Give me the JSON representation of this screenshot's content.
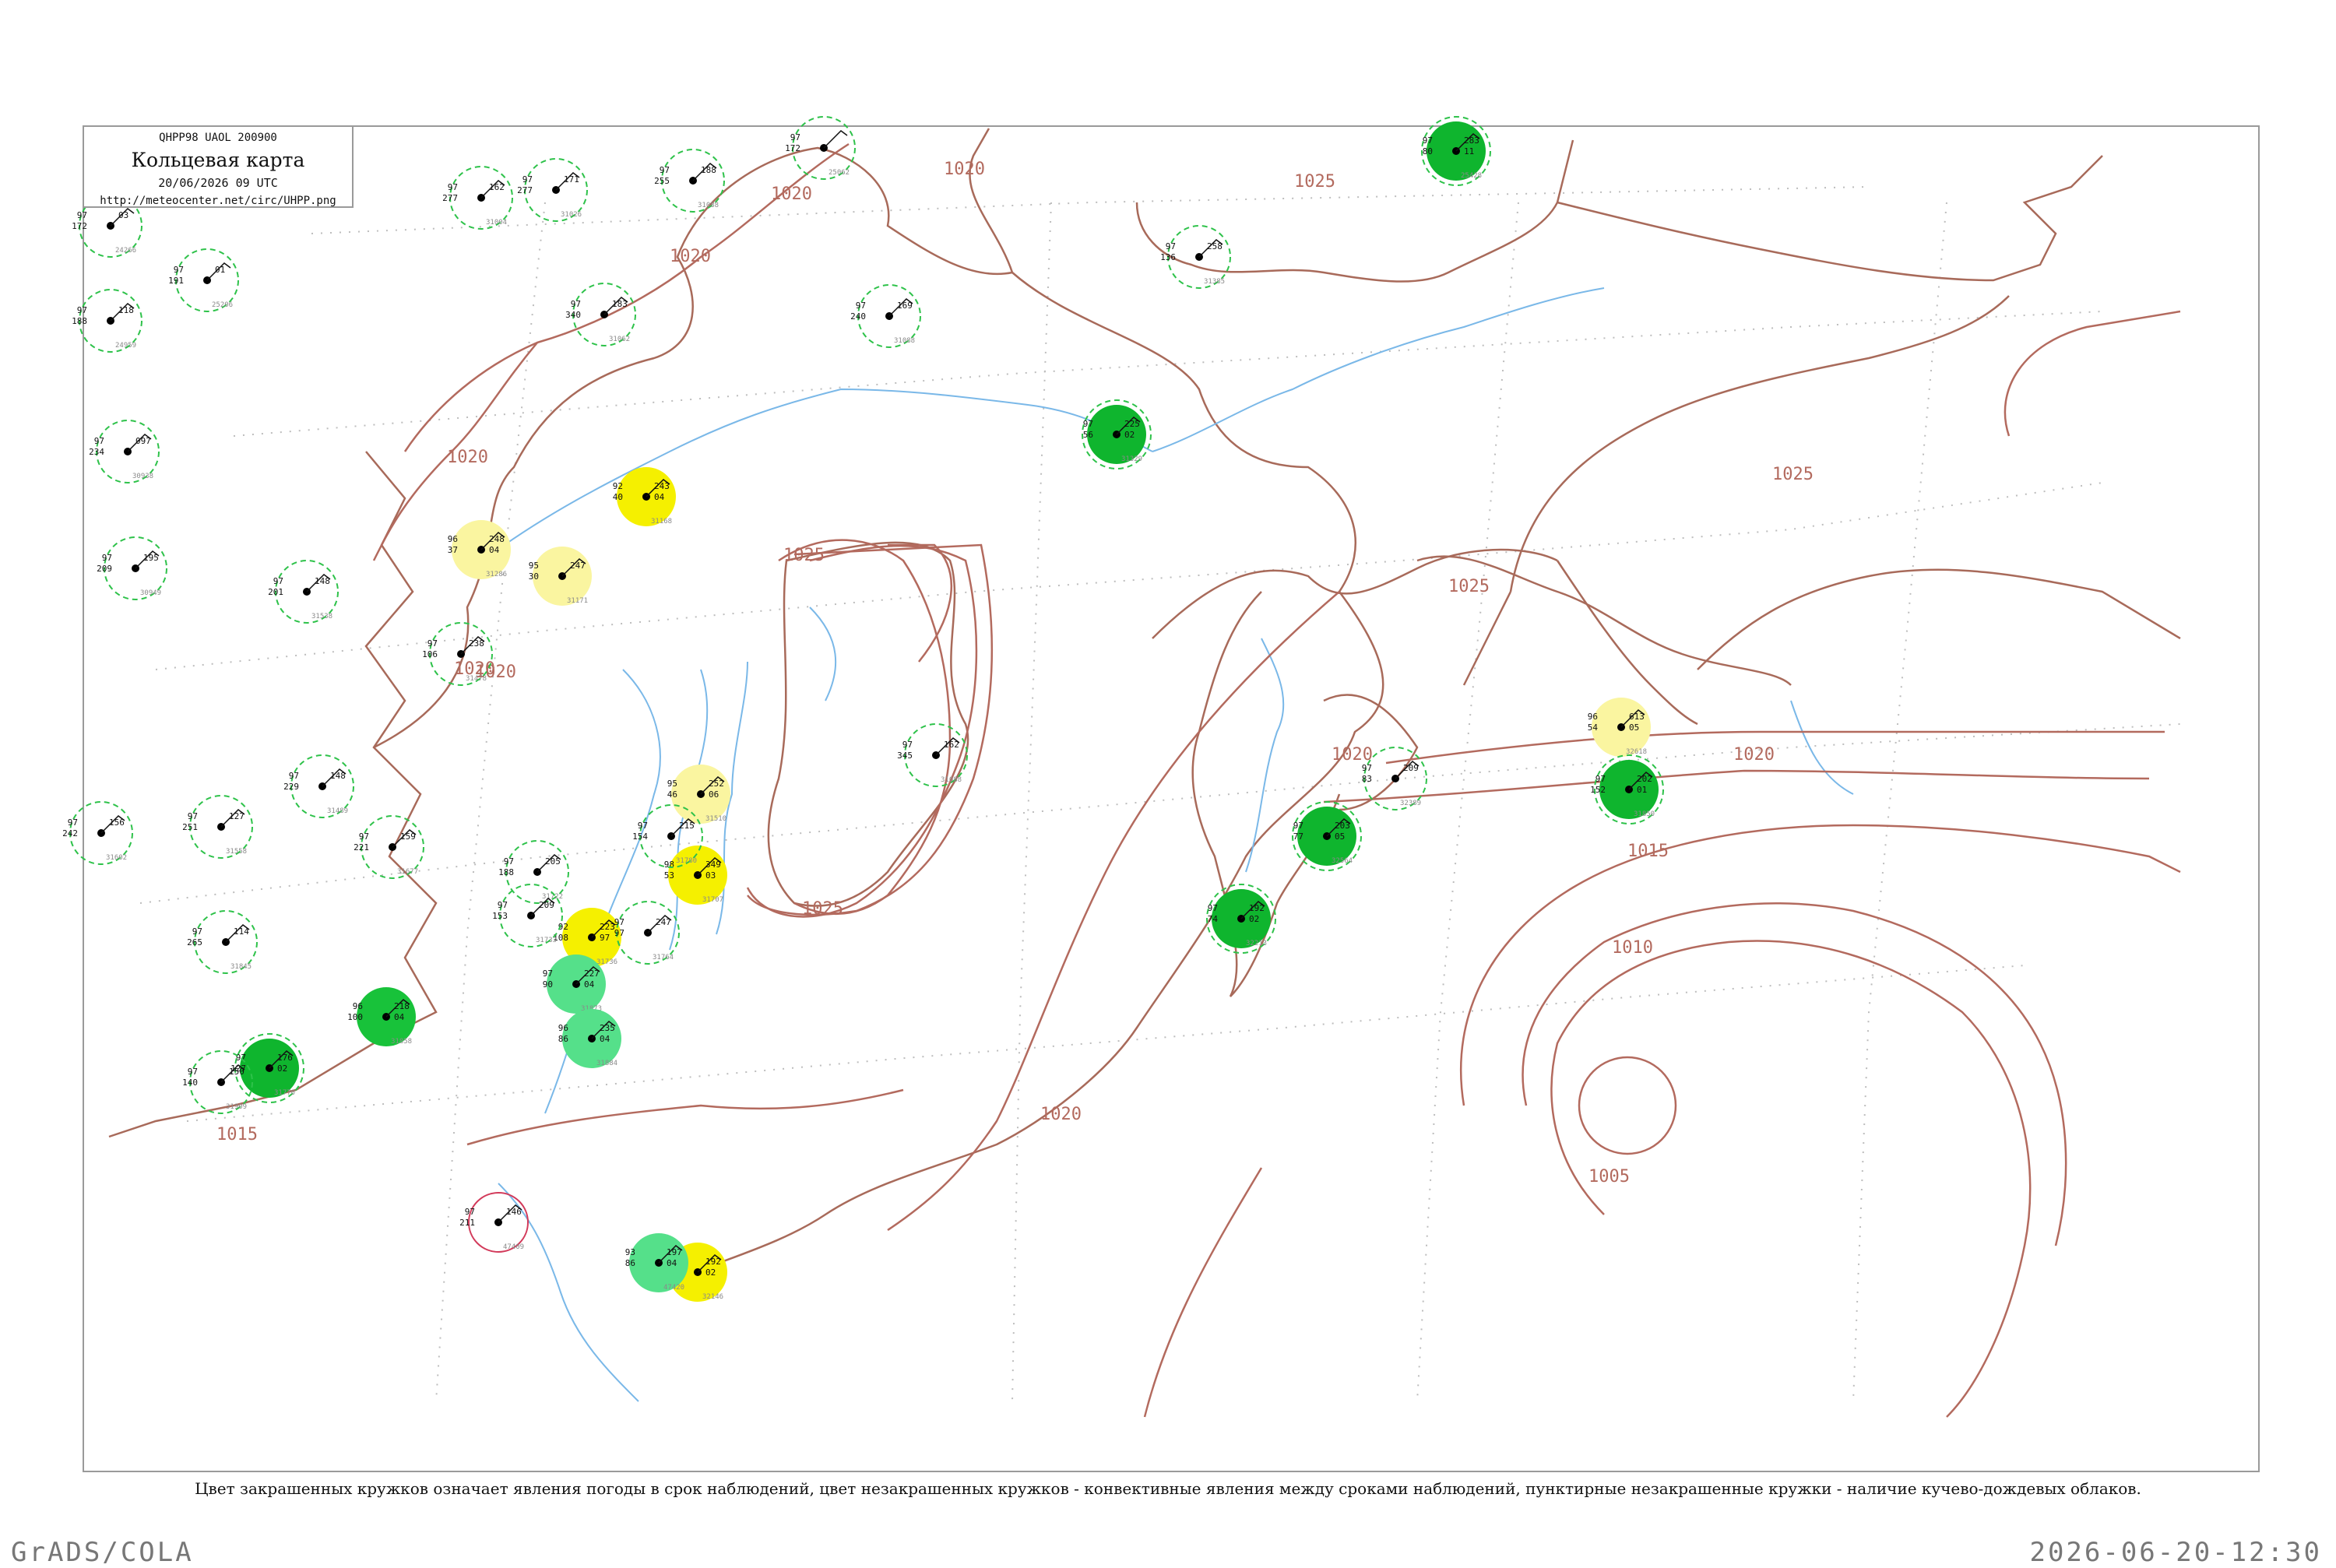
{
  "title_box": {
    "code": "QHPP98  UAOL  200900",
    "title": "Кольцевая карта",
    "datetime": "20/06/2026 09 UTC",
    "url": "http://meteocenter.net/circ/UHPP.png"
  },
  "caption": "Цвет закрашенных кружков означает явления погоды в срок наблюдений, цвет незакрашенных кружков - конвективные явления между сроками наблюдений, пунктирные незакрашенные кружки - наличие кучево-дождевых облаков.",
  "footer": {
    "left": "GrADS/COLA",
    "right": "2026-06-20-12:30"
  },
  "colors": {
    "isobar": "#b36a5e",
    "coast": "#a86a5a",
    "river": "#7ab8e8",
    "cb_dashed": "#2ec24a",
    "fill_yellow": "#f5f000",
    "fill_light_yellow": "#faf5a0",
    "fill_green": "#18c23a",
    "fill_light_green": "#55e08a",
    "fill_dark_green": "#0fb52e"
  },
  "isobars": [
    "1020",
    "1020",
    "1020",
    "1020",
    "1025",
    "1025",
    "1025",
    "1025",
    "1025",
    "1020",
    "1020",
    "1015",
    "1010",
    "1005",
    "1020",
    "1015",
    "1020",
    "1020"
  ],
  "stations": [
    {
      "number": "31168",
      "left": [
        "92",
        "40"
      ],
      "right": [
        "243",
        "04"
      ],
      "kind": "fill_yellow",
      "icon": "station-circle-icon"
    },
    {
      "number": "31286",
      "left": [
        "96",
        "37"
      ],
      "right": [
        "248",
        "04"
      ],
      "kind": "fill_light_yellow",
      "icon": "station-circle-icon"
    },
    {
      "number": "31171",
      "left": [
        "95",
        "30"
      ],
      "right": [
        "247"
      ],
      "kind": "fill_light_yellow",
      "icon": "station-circle-icon"
    },
    {
      "number": "31510",
      "left": [
        "95",
        "46"
      ],
      "right": [
        "252",
        "06"
      ],
      "kind": "fill_light_yellow",
      "icon": "station-circle-icon"
    },
    {
      "number": "31707",
      "left": [
        "98",
        "53"
      ],
      "right": [
        "349",
        "03"
      ],
      "kind": "fill_yellow",
      "icon": "station-circle-icon"
    },
    {
      "number": "32618",
      "left": [
        "96",
        "54"
      ],
      "right": [
        "613",
        "05"
      ],
      "kind": "fill_light_yellow",
      "icon": "station-circle-icon"
    },
    {
      "number": "31736",
      "left": [
        "92",
        "108"
      ],
      "right": [
        "223",
        "97"
      ],
      "kind": "fill_yellow",
      "icon": "station-circle-icon"
    },
    {
      "number": "32146",
      "left": [
        "98",
        "80"
      ],
      "right": [
        "192",
        "02"
      ],
      "kind": "fill_yellow",
      "icon": "station-circle-icon"
    },
    {
      "number": "31873",
      "left": [
        "97",
        "90"
      ],
      "right": [
        "227",
        "04"
      ],
      "kind": "fill_light_green",
      "icon": "station-circle-icon"
    },
    {
      "number": "31884",
      "left": [
        "96",
        "86"
      ],
      "right": [
        "235",
        "04"
      ],
      "kind": "fill_light_green",
      "icon": "station-circle-icon"
    },
    {
      "number": "31858",
      "left": [
        "96",
        "100"
      ],
      "right": [
        "218",
        "04"
      ],
      "kind": "fill_green",
      "icon": "station-circle-icon"
    },
    {
      "number": "47420",
      "left": [
        "93",
        "86"
      ],
      "right": [
        "197",
        "04"
      ],
      "kind": "fill_light_green",
      "icon": "station-circle-icon"
    },
    {
      "number": "31770",
      "left": [
        "97",
        "127"
      ],
      "right": [
        "176",
        "02"
      ],
      "kind": "fill_dark_green",
      "icon": "station-circle-icon"
    },
    {
      "number": "32213",
      "left": [
        "97",
        "74"
      ],
      "right": [
        "192",
        "02"
      ],
      "kind": "fill_dark_green",
      "icon": "station-circle-icon"
    },
    {
      "number": "32564",
      "left": [
        "97",
        "77"
      ],
      "right": [
        "203",
        "05"
      ],
      "kind": "fill_dark_green",
      "icon": "station-circle-icon"
    },
    {
      "number": "31329",
      "left": [
        "97",
        "56"
      ],
      "right": [
        "225",
        "02"
      ],
      "kind": "fill_dark_green",
      "icon": "station-circle-icon"
    },
    {
      "number": "25428",
      "left": [
        "97",
        "80"
      ],
      "right": [
        "283",
        "11"
      ],
      "kind": "fill_dark_green",
      "icon": "station-circle-icon"
    },
    {
      "number": "31850",
      "left": [
        "97",
        "152"
      ],
      "right": [
        "202",
        "01"
      ],
      "kind": "fill_dark_green",
      "icon": "station-circle-icon"
    },
    {
      "number": "24266",
      "left": [
        "97",
        "172"
      ],
      "right": [
        "03"
      ],
      "kind": "cb_dashed",
      "icon": "station-circle-icon"
    },
    {
      "number": "24959",
      "left": [
        "97",
        "188"
      ],
      "right": [
        "118"
      ],
      "kind": "cb_dashed",
      "icon": "station-circle-icon"
    },
    {
      "number": "25206",
      "left": [
        "97",
        "191"
      ],
      "right": [
        "01"
      ],
      "kind": "cb_dashed",
      "icon": "station-circle-icon"
    },
    {
      "number": "30938",
      "left": [
        "97",
        "234"
      ],
      "right": [
        "097"
      ],
      "kind": "cb_dashed",
      "icon": "station-circle-icon"
    },
    {
      "number": "30949",
      "left": [
        "97",
        "209"
      ],
      "right": [
        "195"
      ],
      "kind": "cb_dashed",
      "icon": "station-circle-icon"
    },
    {
      "number": "31004",
      "left": [
        "97",
        "277"
      ],
      "right": [
        "162"
      ],
      "kind": "cb_dashed",
      "icon": "station-circle-icon"
    },
    {
      "number": "31026",
      "left": [
        "97",
        "277"
      ],
      "right": [
        "171"
      ],
      "kind": "cb_dashed",
      "icon": "station-circle-icon"
    },
    {
      "number": "31062",
      "left": [
        "97",
        "340"
      ],
      "right": [
        "183"
      ],
      "kind": "cb_dashed",
      "icon": "station-circle-icon"
    },
    {
      "number": "31088",
      "left": [
        "97",
        "255"
      ],
      "right": [
        "188"
      ],
      "kind": "cb_dashed",
      "icon": "station-circle-icon"
    },
    {
      "number": "25062",
      "left": [
        "97",
        "172"
      ],
      "right": [],
      "kind": "cb_dashed",
      "icon": "station-circle-icon"
    },
    {
      "number": "31088b",
      "left": [
        "97",
        "345"
      ],
      "right": [
        "162"
      ],
      "kind": "cb_dashed",
      "icon": "station-circle-icon"
    },
    {
      "number": "31088c",
      "left": [
        "97",
        "240"
      ],
      "right": [
        "169"
      ],
      "kind": "cb_dashed",
      "icon": "station-circle-icon"
    },
    {
      "number": "31385",
      "left": [
        "97",
        "136"
      ],
      "right": [
        "258"
      ],
      "kind": "cb_dashed",
      "icon": "station-circle-icon"
    },
    {
      "number": "31538",
      "left": [
        "97",
        "201"
      ],
      "right": [
        "148"
      ],
      "kind": "cb_dashed",
      "icon": "station-circle-icon"
    },
    {
      "number": "31478",
      "left": [
        "97",
        "106"
      ],
      "right": [
        "238"
      ],
      "kind": "cb_dashed",
      "icon": "station-circle-icon"
    },
    {
      "number": "31489",
      "left": [
        "97",
        "229"
      ],
      "right": [
        "148"
      ],
      "kind": "cb_dashed",
      "icon": "station-circle-icon"
    },
    {
      "number": "31558",
      "left": [
        "97",
        "251"
      ],
      "right": [
        "127"
      ],
      "kind": "cb_dashed",
      "icon": "station-circle-icon"
    },
    {
      "number": "31602",
      "left": [
        "97",
        "242"
      ],
      "right": [
        "156"
      ],
      "kind": "cb_dashed",
      "icon": "station-circle-icon"
    },
    {
      "number": "31677",
      "left": [
        "97",
        "221"
      ],
      "right": [
        "159"
      ],
      "kind": "cb_dashed",
      "icon": "station-circle-icon"
    },
    {
      "number": "31722",
      "left": [
        "97",
        "188"
      ],
      "right": [
        "205"
      ],
      "kind": "cb_dashed",
      "icon": "station-circle-icon"
    },
    {
      "number": "31733",
      "left": [
        "97",
        "153"
      ],
      "right": [
        "209"
      ],
      "kind": "cb_dashed",
      "icon": "station-circle-icon"
    },
    {
      "number": "31764",
      "left": [
        "97",
        "97"
      ],
      "right": [
        "247"
      ],
      "kind": "cb_dashed",
      "icon": "station-circle-icon"
    },
    {
      "number": "31780",
      "left": [
        "97",
        "154"
      ],
      "right": [
        "215"
      ],
      "kind": "cb_dashed",
      "icon": "station-circle-icon"
    },
    {
      "number": "31845",
      "left": [
        "97",
        "265"
      ],
      "right": [
        "114"
      ],
      "kind": "cb_dashed",
      "icon": "station-circle-icon"
    },
    {
      "number": "32389",
      "left": [
        "97",
        "83"
      ],
      "right": [
        "209"
      ],
      "kind": "cb_dashed",
      "icon": "station-circle-icon"
    },
    {
      "number": "31909",
      "left": [
        "97",
        "140"
      ],
      "right": [
        "150"
      ],
      "kind": "cb_dashed",
      "icon": "station-circle-icon"
    },
    {
      "number": "47409",
      "left": [
        "97",
        "211"
      ],
      "right": [
        "146"
      ],
      "kind": "red_circle",
      "icon": "station-circle-icon"
    }
  ]
}
